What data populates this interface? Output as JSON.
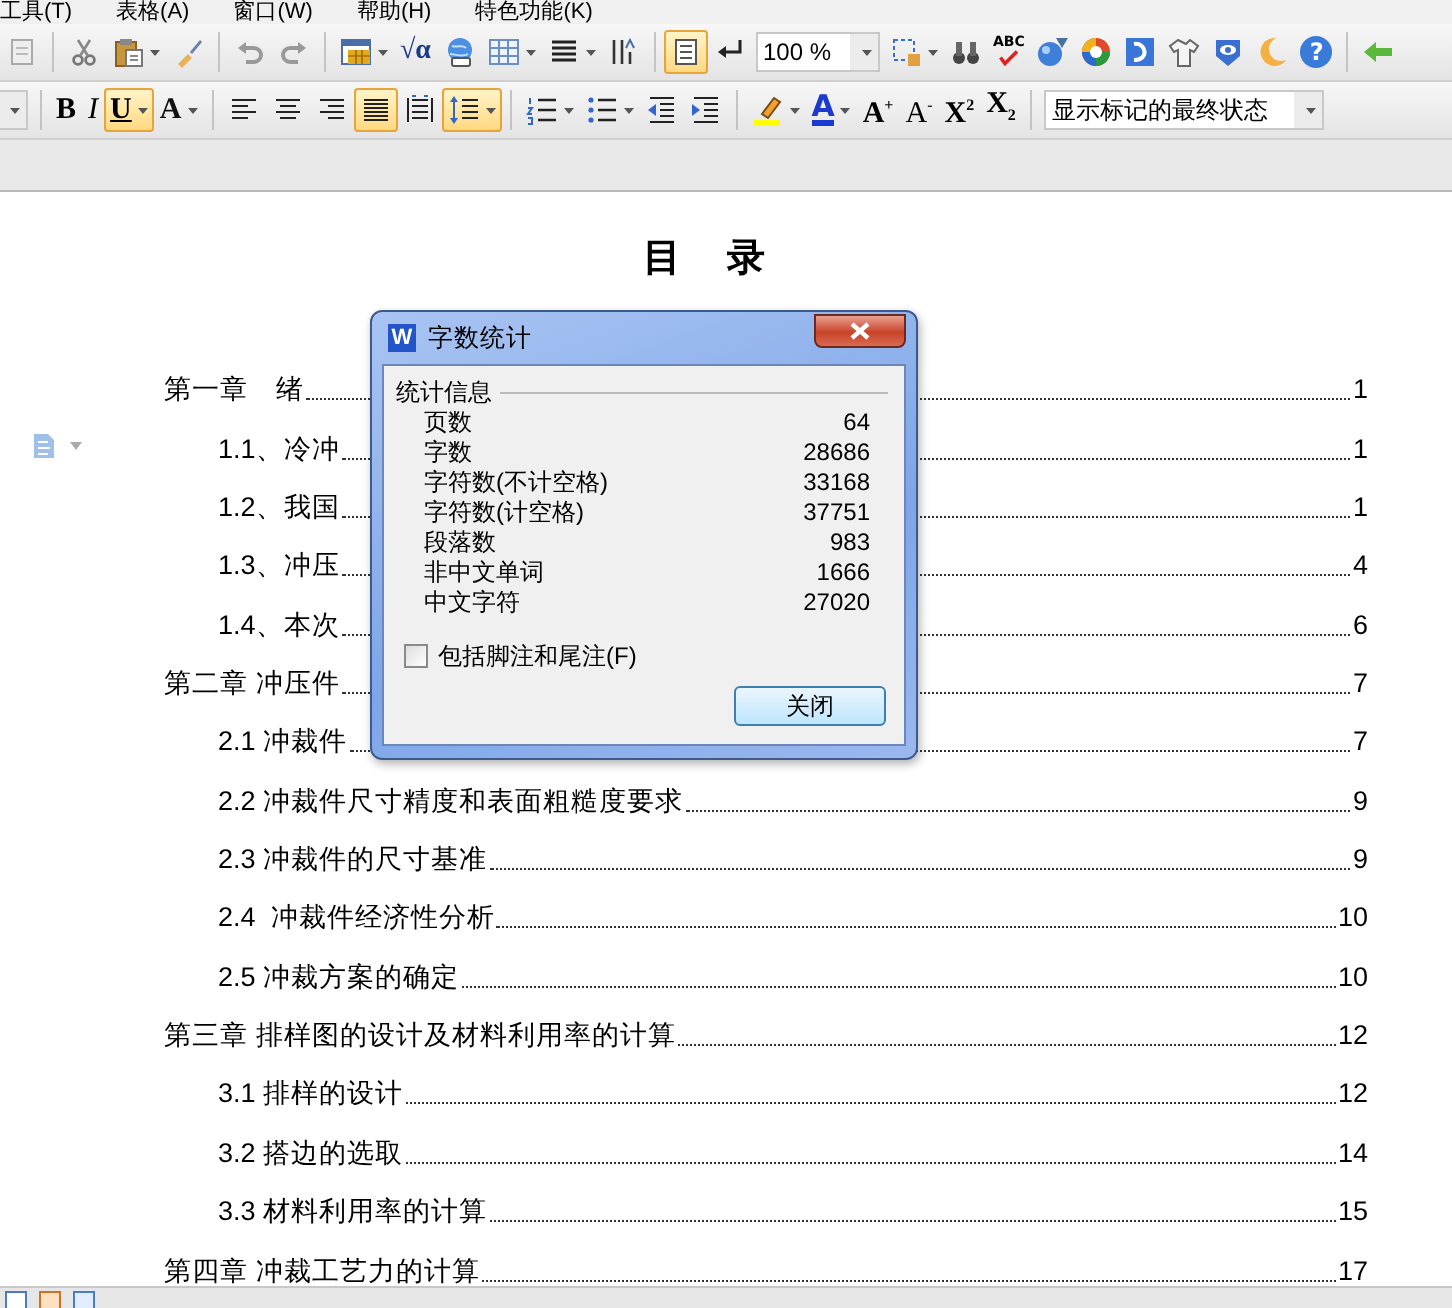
{
  "menu_bar": [
    "工具(T)",
    "表格(A)",
    "窗口(W)",
    "帮助(H)",
    "特色功能(K)"
  ],
  "toolbar_1": {
    "items": [
      {
        "kind": "newdoc",
        "on": false
      },
      {
        "kind": "separator"
      },
      {
        "kind": "cut",
        "on": false
      },
      {
        "kind": "paste",
        "on": false,
        "dropdown": true
      },
      {
        "kind": "painter",
        "on": false
      },
      {
        "kind": "separator"
      },
      {
        "kind": "undo",
        "on": false
      },
      {
        "kind": "redo",
        "on": false
      },
      {
        "kind": "separator"
      },
      {
        "kind": "chartgrid",
        "on": false,
        "dropdown": true
      },
      {
        "kind": "formula",
        "label": "√α",
        "on": false
      },
      {
        "kind": "globe",
        "on": false
      },
      {
        "kind": "table",
        "on": false,
        "dropdown": true
      },
      {
        "kind": "columns",
        "on": false,
        "dropdown": true
      },
      {
        "kind": "sortbars",
        "on": false
      },
      {
        "kind": "separator"
      },
      {
        "kind": "reading",
        "on": true
      },
      {
        "kind": "returnarrow",
        "on": false
      },
      {
        "kind": "zoom",
        "value": "100 %"
      },
      {
        "kind": "select",
        "on": false,
        "dropdown": true
      },
      {
        "kind": "binoculars",
        "on": false
      },
      {
        "kind": "spellcheck",
        "label": "ABC"
      },
      {
        "kind": "ball",
        "on": false
      },
      {
        "kind": "colorwheel",
        "on": false
      },
      {
        "kind": "dlogo",
        "on": false
      },
      {
        "kind": "shirt",
        "on": false
      },
      {
        "kind": "shield",
        "on": false
      },
      {
        "kind": "moon",
        "on": false
      },
      {
        "kind": "help",
        "label": "?",
        "on": false
      },
      {
        "kind": "separator"
      },
      {
        "kind": "backarrow",
        "on": false
      }
    ]
  },
  "toolbar_2": {
    "items": [
      {
        "kind": "fontsize"
      },
      {
        "kind": "separator"
      },
      {
        "kind": "bold",
        "label": "B",
        "on": false
      },
      {
        "kind": "italic",
        "label": "I",
        "on": false
      },
      {
        "kind": "underline",
        "label": "U",
        "on": true,
        "dropdown": true
      },
      {
        "kind": "texteffect",
        "label": "A",
        "on": false,
        "dropdown": true
      },
      {
        "kind": "separator"
      },
      {
        "kind": "alignleft",
        "on": false
      },
      {
        "kind": "aligncenter",
        "on": false
      },
      {
        "kind": "alignright",
        "on": false
      },
      {
        "kind": "justify",
        "on": true
      },
      {
        "kind": "distribute",
        "on": false
      },
      {
        "kind": "linespacing",
        "on": true,
        "dropdown": true
      },
      {
        "kind": "separator"
      },
      {
        "kind": "numbering",
        "on": false,
        "dropdown": true
      },
      {
        "kind": "bullets",
        "on": false,
        "dropdown": true
      },
      {
        "kind": "outdent",
        "on": false
      },
      {
        "kind": "indent",
        "on": false
      },
      {
        "kind": "separator"
      },
      {
        "kind": "highlight",
        "on": false,
        "dropdown": true
      },
      {
        "kind": "fontcolor",
        "label": "A",
        "on": false,
        "dropdown": true
      },
      {
        "kind": "grow",
        "label": "A$^{+}$",
        "on": false
      },
      {
        "kind": "shrink",
        "label": "A$^{-}$",
        "on": false
      },
      {
        "kind": "superscript",
        "label": "X$^{2}$",
        "on": false
      },
      {
        "kind": "subscript",
        "label": "X$_{2}$",
        "on": false
      },
      {
        "kind": "separator"
      },
      {
        "kind": "style",
        "value": "显示标记的最终状态"
      }
    ]
  },
  "document": {
    "title": "目　录",
    "toc": [
      {
        "text": "第一章　绪",
        "page": "1",
        "children": [
          {
            "text": "1.1、冷冲",
            "page": "1"
          },
          {
            "text": "1.2、我国",
            "page": "1"
          },
          {
            "text": "1.3、冲压",
            "page": "4"
          },
          {
            "text": "1.4、本次",
            "page": "6"
          }
        ]
      },
      {
        "text": "第二章 冲压件",
        "page": "7",
        "children": [
          {
            "text": "2.1 冲裁件",
            "page": "7"
          },
          {
            "text": "2.2 冲裁件尺寸精度和表面粗糙度要求",
            "page": "9"
          },
          {
            "text": "2.3 冲裁件的尺寸基准",
            "page": "9"
          },
          {
            "text": "2.4  冲裁件经济性分析",
            "page": "10"
          },
          {
            "text": "2.5 冲裁方案的确定",
            "page": "10"
          }
        ]
      },
      {
        "text": "第三章 排样图的设计及材料利用率的计算",
        "page": "12",
        "children": [
          {
            "text": "3.1 排样的设计",
            "page": "12"
          },
          {
            "text": "3.2 搭边的选取",
            "page": "14"
          },
          {
            "text": "3.3 材料利用率的计算",
            "page": "15"
          }
        ]
      },
      {
        "text": "第四章 冲裁工艺力的计算",
        "page": "17"
      }
    ]
  },
  "dialog": {
    "logo": "W",
    "title": "字数统计",
    "group": "统计信息",
    "stats": [
      {
        "label": "页数",
        "value": "64"
      },
      {
        "label": "字数",
        "value": "28686"
      },
      {
        "label": "字符数(不计空格)",
        "value": "33168"
      },
      {
        "label": "字符数(计空格)",
        "value": "37751"
      },
      {
        "label": "段落数",
        "value": "983"
      },
      {
        "label": "非中文单词",
        "value": "1666"
      },
      {
        "label": "中文字符",
        "value": "27020"
      }
    ],
    "checkbox": {
      "label": "包括脚注和尾注(F)",
      "checked": false
    },
    "button": "关闭"
  }
}
